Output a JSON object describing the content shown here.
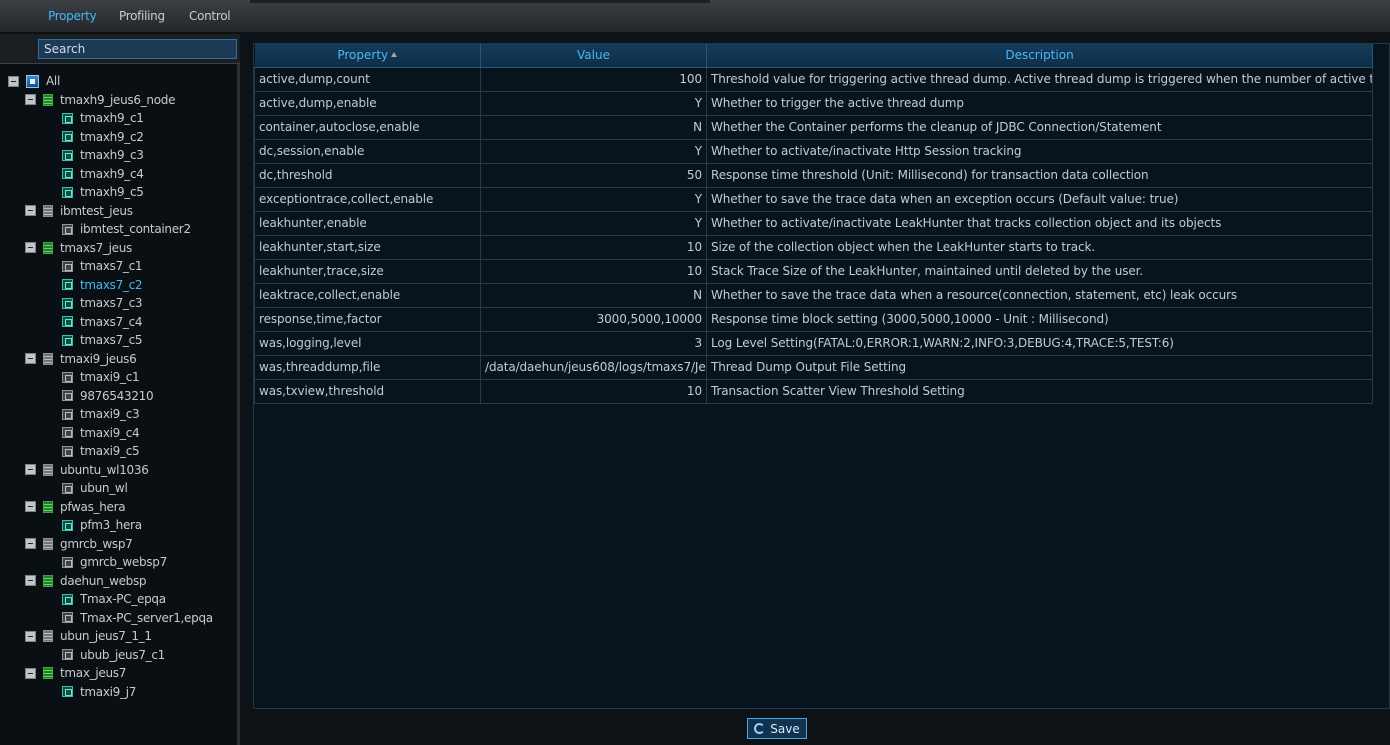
{
  "tabs": [
    {
      "label": "Property",
      "active": true
    },
    {
      "label": "Profiling",
      "active": false
    },
    {
      "label": "Control",
      "active": false
    }
  ],
  "search": {
    "placeholder": "Search"
  },
  "tree": [
    {
      "label": "All",
      "level": 0,
      "icon": "root",
      "toggle": true
    },
    {
      "label": "tmaxh9_jeus6_node",
      "level": 1,
      "icon": "server-on",
      "toggle": true
    },
    {
      "label": "tmaxh9_c1",
      "level": 2,
      "icon": "container-on"
    },
    {
      "label": "tmaxh9_c2",
      "level": 2,
      "icon": "container-on"
    },
    {
      "label": "tmaxh9_c3",
      "level": 2,
      "icon": "container-on"
    },
    {
      "label": "tmaxh9_c4",
      "level": 2,
      "icon": "container-on"
    },
    {
      "label": "tmaxh9_c5",
      "level": 2,
      "icon": "container-on"
    },
    {
      "label": "ibmtest_jeus",
      "level": 1,
      "icon": "server-off",
      "toggle": true
    },
    {
      "label": "ibmtest_container2",
      "level": 2,
      "icon": "container-off"
    },
    {
      "label": "tmaxs7_jeus",
      "level": 1,
      "icon": "server-on",
      "toggle": true
    },
    {
      "label": "tmaxs7_c1",
      "level": 2,
      "icon": "container-off"
    },
    {
      "label": "tmaxs7_c2",
      "level": 2,
      "icon": "container-on",
      "selected": true
    },
    {
      "label": "tmaxs7_c3",
      "level": 2,
      "icon": "container-on"
    },
    {
      "label": "tmaxs7_c4",
      "level": 2,
      "icon": "container-on"
    },
    {
      "label": "tmaxs7_c5",
      "level": 2,
      "icon": "container-on"
    },
    {
      "label": "tmaxi9_jeus6",
      "level": 1,
      "icon": "server-off",
      "toggle": true
    },
    {
      "label": "tmaxi9_c1",
      "level": 2,
      "icon": "container-off"
    },
    {
      "label": "9876543210",
      "level": 2,
      "icon": "container-off"
    },
    {
      "label": "tmaxi9_c3",
      "level": 2,
      "icon": "container-off"
    },
    {
      "label": "tmaxi9_c4",
      "level": 2,
      "icon": "container-off"
    },
    {
      "label": "tmaxi9_c5",
      "level": 2,
      "icon": "container-off"
    },
    {
      "label": "ubuntu_wl1036",
      "level": 1,
      "icon": "server-off",
      "toggle": true
    },
    {
      "label": "ubun_wl",
      "level": 2,
      "icon": "container-off"
    },
    {
      "label": "pfwas_hera",
      "level": 1,
      "icon": "server-on",
      "toggle": true
    },
    {
      "label": "pfm3_hera",
      "level": 2,
      "icon": "container-on"
    },
    {
      "label": "gmrcb_wsp7",
      "level": 1,
      "icon": "server-off",
      "toggle": true
    },
    {
      "label": "gmrcb_websp7",
      "level": 2,
      "icon": "container-off"
    },
    {
      "label": "daehun_websp",
      "level": 1,
      "icon": "server-on",
      "toggle": true
    },
    {
      "label": "Tmax-PC_epqa",
      "level": 2,
      "icon": "container-on"
    },
    {
      "label": "Tmax-PC_server1,epqa",
      "level": 2,
      "icon": "container-off"
    },
    {
      "label": "ubun_jeus7_1_1",
      "level": 1,
      "icon": "server-off",
      "toggle": true
    },
    {
      "label": "ubub_jeus7_c1",
      "level": 2,
      "icon": "container-off"
    },
    {
      "label": "tmax_jeus7",
      "level": 1,
      "icon": "server-on",
      "toggle": true
    },
    {
      "label": "tmaxi9_j7",
      "level": 2,
      "icon": "container-on"
    }
  ],
  "table": {
    "columns": [
      "Property",
      "Value",
      "Description"
    ],
    "sort_column": "Property",
    "rows": [
      {
        "property": "active,dump,count",
        "value": "100",
        "description": "Threshold value for triggering active thread dump. Active thread dump is triggered when the number of active threads"
      },
      {
        "property": "active,dump,enable",
        "value": "Y",
        "description": "Whether to trigger the active thread dump"
      },
      {
        "property": "container,autoclose,enable",
        "value": "N",
        "description": "Whether the Container performs the cleanup of JDBC Connection/Statement"
      },
      {
        "property": "dc,session,enable",
        "value": "Y",
        "description": "Whether to activate/inactivate Http Session tracking"
      },
      {
        "property": "dc,threshold",
        "value": "50",
        "description": "Response time threshold (Unit: Millisecond) for transaction data collection"
      },
      {
        "property": "exceptiontrace,collect,enable",
        "value": "Y",
        "description": "Whether to save the trace data when an exception occurs (Default value: true)"
      },
      {
        "property": "leakhunter,enable",
        "value": "Y",
        "description": "Whether to activate/inactivate LeakHunter that tracks collection object and its objects"
      },
      {
        "property": "leakhunter,start,size",
        "value": "10",
        "description": "Size of the collection object when the LeakHunter starts to track."
      },
      {
        "property": "leakhunter,trace,size",
        "value": "10",
        "description": "Stack Trace Size of the LeakHunter, maintained until deleted by the user."
      },
      {
        "property": "leaktrace,collect,enable",
        "value": "N",
        "description": "Whether to save the trace data when a resource(connection, statement, etc) leak occurs"
      },
      {
        "property": "response,time,factor",
        "value": "3000,5000,10000",
        "description": "Response time block setting (3000,5000,10000 - Unit : Millisecond)"
      },
      {
        "property": "was,logging,level",
        "value": "3",
        "description": "Log Level Setting(FATAL:0,ERROR:1,WARN:2,INFO:3,DEBUG:4,TRACE:5,TEST:6)"
      },
      {
        "property": "was,threaddump,file",
        "value": "/data/daehun/jeus608/logs/tmaxs7/Je",
        "description": "Thread Dump Output File Setting",
        "value_align": "left"
      },
      {
        "property": "was,txview,threshold",
        "value": "10",
        "description": "Transaction Scatter View Threshold Setting"
      }
    ]
  },
  "save_label": "Save"
}
